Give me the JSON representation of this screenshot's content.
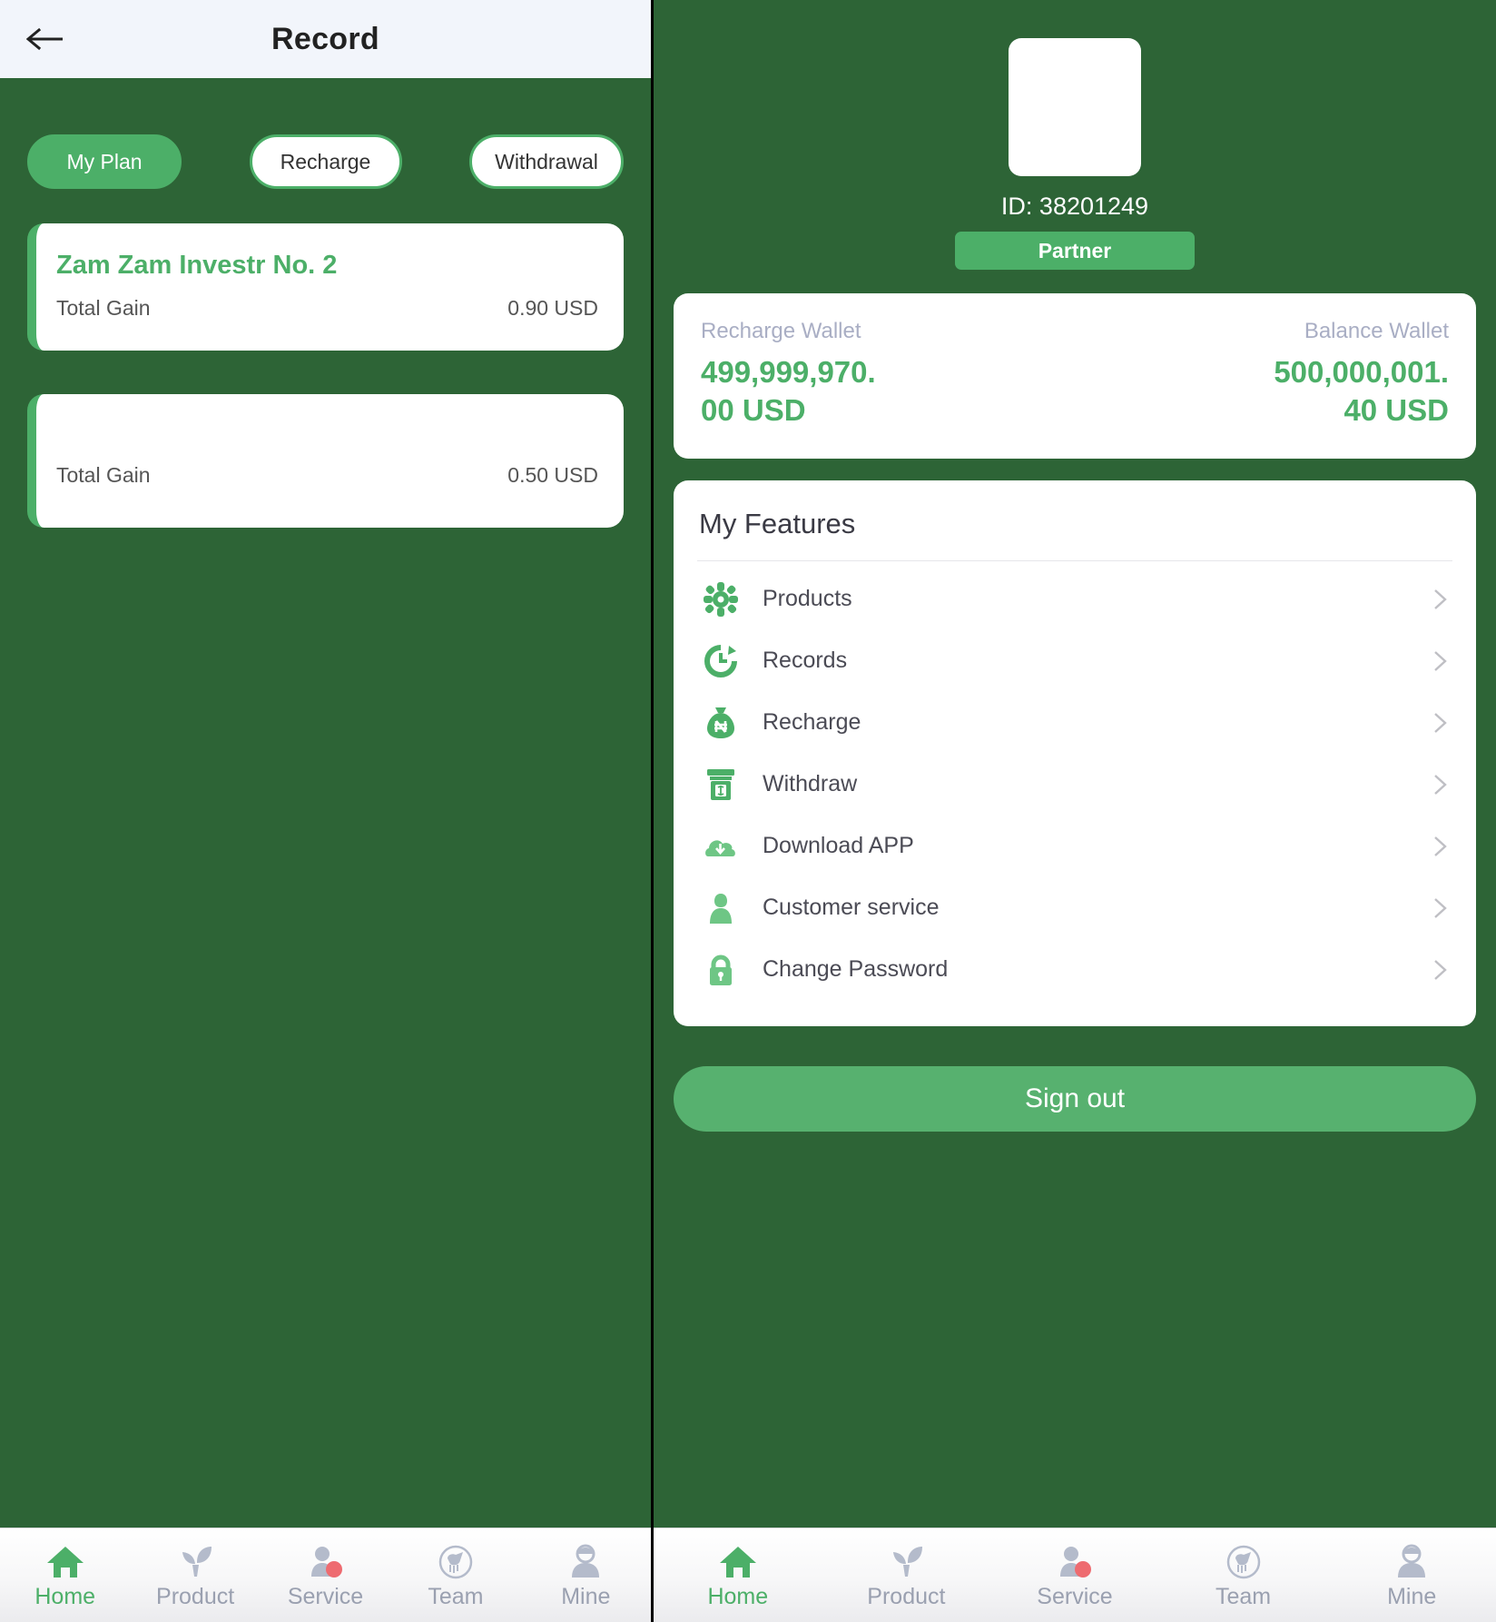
{
  "colors": {
    "screen_bg": "#2d6436",
    "accent_green": "#4caf68",
    "appbar_bg": "#f2f5fb",
    "card_white": "#ffffff",
    "muted_label": "#a9aec4",
    "nav_inactive": "#9aa0b0",
    "badge_red": "#ee6b70"
  },
  "record_screen": {
    "appbar": {
      "back_icon": "arrow-left-icon",
      "title": "Record"
    },
    "tabs": [
      {
        "label": "My Plan",
        "active": true
      },
      {
        "label": "Recharge",
        "active": false
      },
      {
        "label": "Withdrawal",
        "active": false
      }
    ],
    "plans": [
      {
        "name": "Zam Zam Investr No. 2",
        "gain_label": "Total Gain",
        "gain_value": "0.90 USD"
      },
      {
        "name": "",
        "gain_label": "Total Gain",
        "gain_value": "0.50 USD"
      }
    ]
  },
  "mine_screen": {
    "profile": {
      "avatar_icon": "avatar-placeholder",
      "id_text": "ID: 38201249",
      "rank_label": "Partner"
    },
    "wallets": [
      {
        "label": "Recharge Wallet",
        "value": "499,999,970.00 USD"
      },
      {
        "label": "Balance Wallet",
        "value": "500,000,001.40 USD"
      }
    ],
    "features": {
      "title": "My Features",
      "items": [
        {
          "label": "Products",
          "icon": "gear-icon",
          "chevron": "chevron-right-icon"
        },
        {
          "label": "Records",
          "icon": "history-icon",
          "chevron": "chevron-right-icon"
        },
        {
          "label": "Recharge",
          "icon": "money-bag-icon",
          "chevron": "chevron-right-icon"
        },
        {
          "label": "Withdraw",
          "icon": "atm-icon",
          "chevron": "chevron-right-icon"
        },
        {
          "label": "Download APP",
          "icon": "cloud-download-icon",
          "chevron": "chevron-right-icon"
        },
        {
          "label": "Customer service",
          "icon": "person-icon",
          "chevron": "chevron-right-icon"
        },
        {
          "label": "Change Password",
          "icon": "lock-icon",
          "chevron": "chevron-right-icon"
        }
      ]
    },
    "signout_label": "Sign out"
  },
  "bottom_nav": {
    "items": [
      {
        "label": "Home",
        "icon": "home-icon",
        "active": true
      },
      {
        "label": "Product",
        "icon": "plant-icon",
        "active": false
      },
      {
        "label": "Service",
        "icon": "support-icon",
        "active": false
      },
      {
        "label": "Team",
        "icon": "team-icon",
        "active": false
      },
      {
        "label": "Mine",
        "icon": "user-icon",
        "active": false
      }
    ]
  }
}
